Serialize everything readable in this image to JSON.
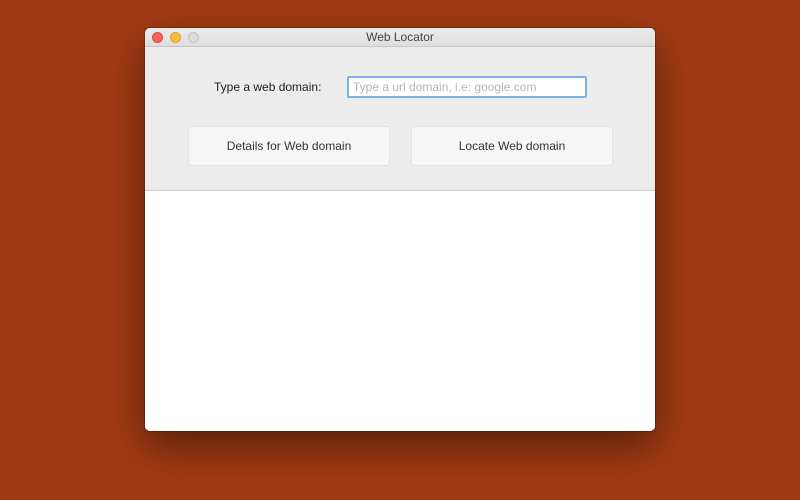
{
  "desktop": {
    "background_color": "#a13a14"
  },
  "window": {
    "title": "Web Locator",
    "controls": {
      "close_color": "#fc605c",
      "minimize_color": "#fdbc40",
      "zoom_color": "#dcdcdc"
    }
  },
  "form": {
    "domain_label": "Type a web domain:",
    "domain_input": {
      "value": "",
      "placeholder": "Type a url domain, i.e: google.com"
    },
    "details_button_label": "Details for Web domain",
    "locate_button_label": "Locate Web domain"
  },
  "content": {
    "results": []
  }
}
